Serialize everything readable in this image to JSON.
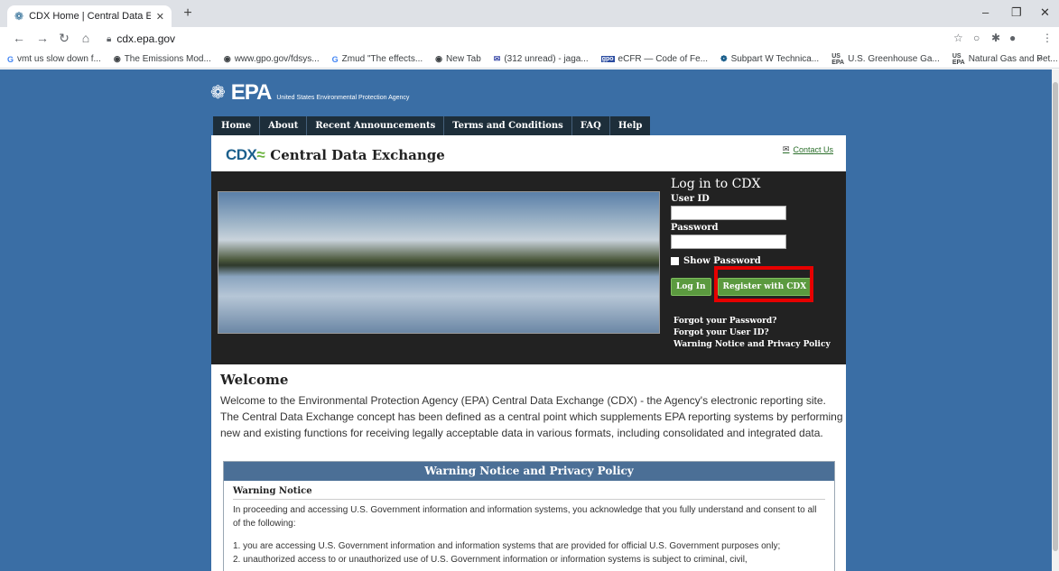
{
  "browser": {
    "tab_title": "CDX Home | Central Data Exchan",
    "url": "cdx.epa.gov",
    "bookmarks": [
      {
        "icon": "G",
        "label": "vmt us slow down f..."
      },
      {
        "icon": "globe",
        "label": "The Emissions Mod..."
      },
      {
        "icon": "globe",
        "label": "www.gpo.gov/fdsys..."
      },
      {
        "icon": "G",
        "label": "Zmud \"The effects..."
      },
      {
        "icon": "globe",
        "label": "New Tab"
      },
      {
        "icon": "mail",
        "label": "(312 unread) - jaga..."
      },
      {
        "icon": "gpo",
        "label": "eCFR — Code of Fe..."
      },
      {
        "icon": "epa",
        "label": "Subpart W Technica..."
      },
      {
        "icon": "usepa",
        "label": "U.S. Greenhouse Ga..."
      },
      {
        "icon": "usepa",
        "label": "Natural Gas and Pet..."
      }
    ],
    "overflow": "»"
  },
  "header": {
    "logo": "EPA",
    "agency": "United States Environmental Protection Agency",
    "nav": [
      "Home",
      "About",
      "Recent Announcements",
      "Terms and Conditions",
      "FAQ",
      "Help"
    ]
  },
  "cdx": {
    "logo": "CDX",
    "title": "Central Data Exchange",
    "contact": "Contact Us"
  },
  "login": {
    "title": "Log in to CDX",
    "user_label": "User ID",
    "user_value": "",
    "password_label": "Password",
    "password_value": "",
    "show_password": "Show Password",
    "login_button": "Log In",
    "register_button": "Register with CDX",
    "links": [
      "Forgot your Password?",
      "Forgot your User ID?",
      "Warning Notice and Privacy Policy"
    ]
  },
  "welcome": {
    "heading": "Welcome",
    "text": "Welcome to the Environmental Protection Agency (EPA) Central Data Exchange (CDX) - the Agency's electronic reporting site. The Central Data Exchange concept has been defined as a central point which supplements EPA reporting systems by performing new and existing functions for receiving legally acceptable data in various formats, including consolidated and integrated data."
  },
  "warning": {
    "header": "Warning Notice and Privacy Policy",
    "subheading": "Warning Notice",
    "intro": "In proceeding and accessing U.S. Government information and information systems, you acknowledge that you fully understand and consent to all of the following:",
    "items": [
      "1. you are accessing U.S. Government information and information systems that are provided for official U.S. Government purposes only;",
      "2. unauthorized access to or unauthorized use of U.S. Government information or information systems is subject to criminal, civil,"
    ]
  },
  "colors": {
    "page_bg": "#3a6ea5",
    "nav_bg": "#1d2e3a",
    "button_green": "#5b9a3f",
    "highlight_red": "#e60000",
    "warn_header": "#4b6f96"
  }
}
